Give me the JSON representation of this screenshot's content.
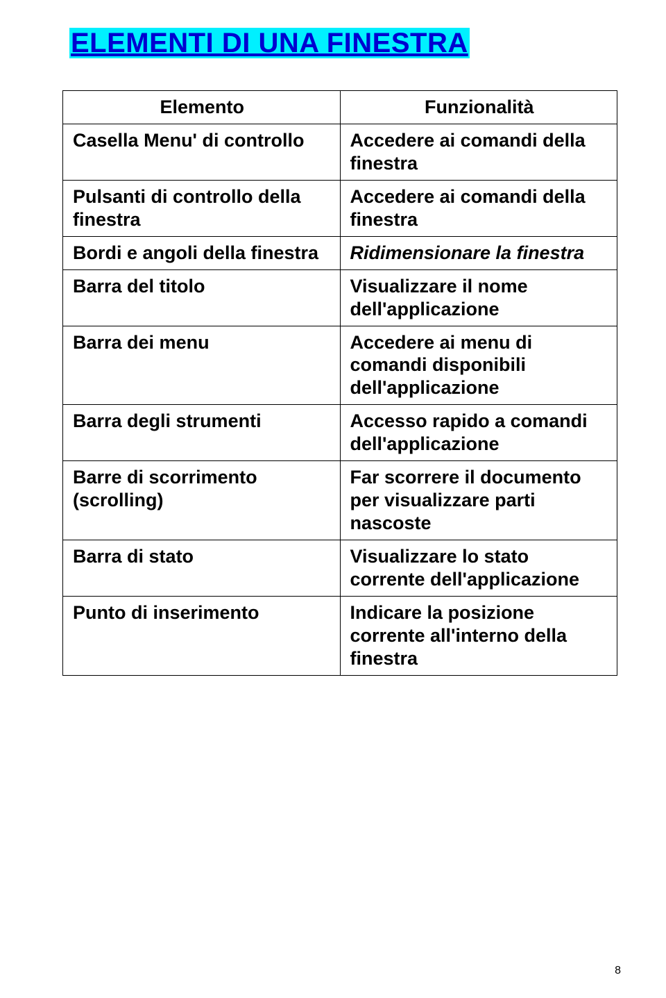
{
  "title": "ELEMENTI DI UNA FINESTRA",
  "header": {
    "left": "Elemento",
    "right": "Funzionalità"
  },
  "rows": [
    {
      "elem": "Casella Menu' di controllo",
      "func": "Accedere ai comandi della finestra"
    },
    {
      "elem": "Pulsanti di controllo della finestra",
      "func": "Accedere ai comandi della finestra"
    },
    {
      "elem": "Bordi e angoli della finestra",
      "func": "Ridimensionare la finestra",
      "italic": true
    },
    {
      "elem": "Barra del titolo",
      "func": "Visualizzare il nome dell'applicazione"
    },
    {
      "elem": "Barra dei menu",
      "func": "Accedere ai menu di comandi disponibili dell'applicazione"
    },
    {
      "elem": "Barra degli strumenti",
      "func": "Accesso rapido a comandi dell'applicazione"
    },
    {
      "elem": "Barre di scorrimento (scrolling)",
      "func": "Far scorrere il documento per visualizzare parti nascoste"
    },
    {
      "elem": "Barra di stato",
      "func": "Visualizzare lo stato corrente dell'applicazione"
    },
    {
      "elem": "Punto di inserimento",
      "func": "Indicare la posizione corrente all'interno della finestra"
    }
  ],
  "page_number": "8"
}
